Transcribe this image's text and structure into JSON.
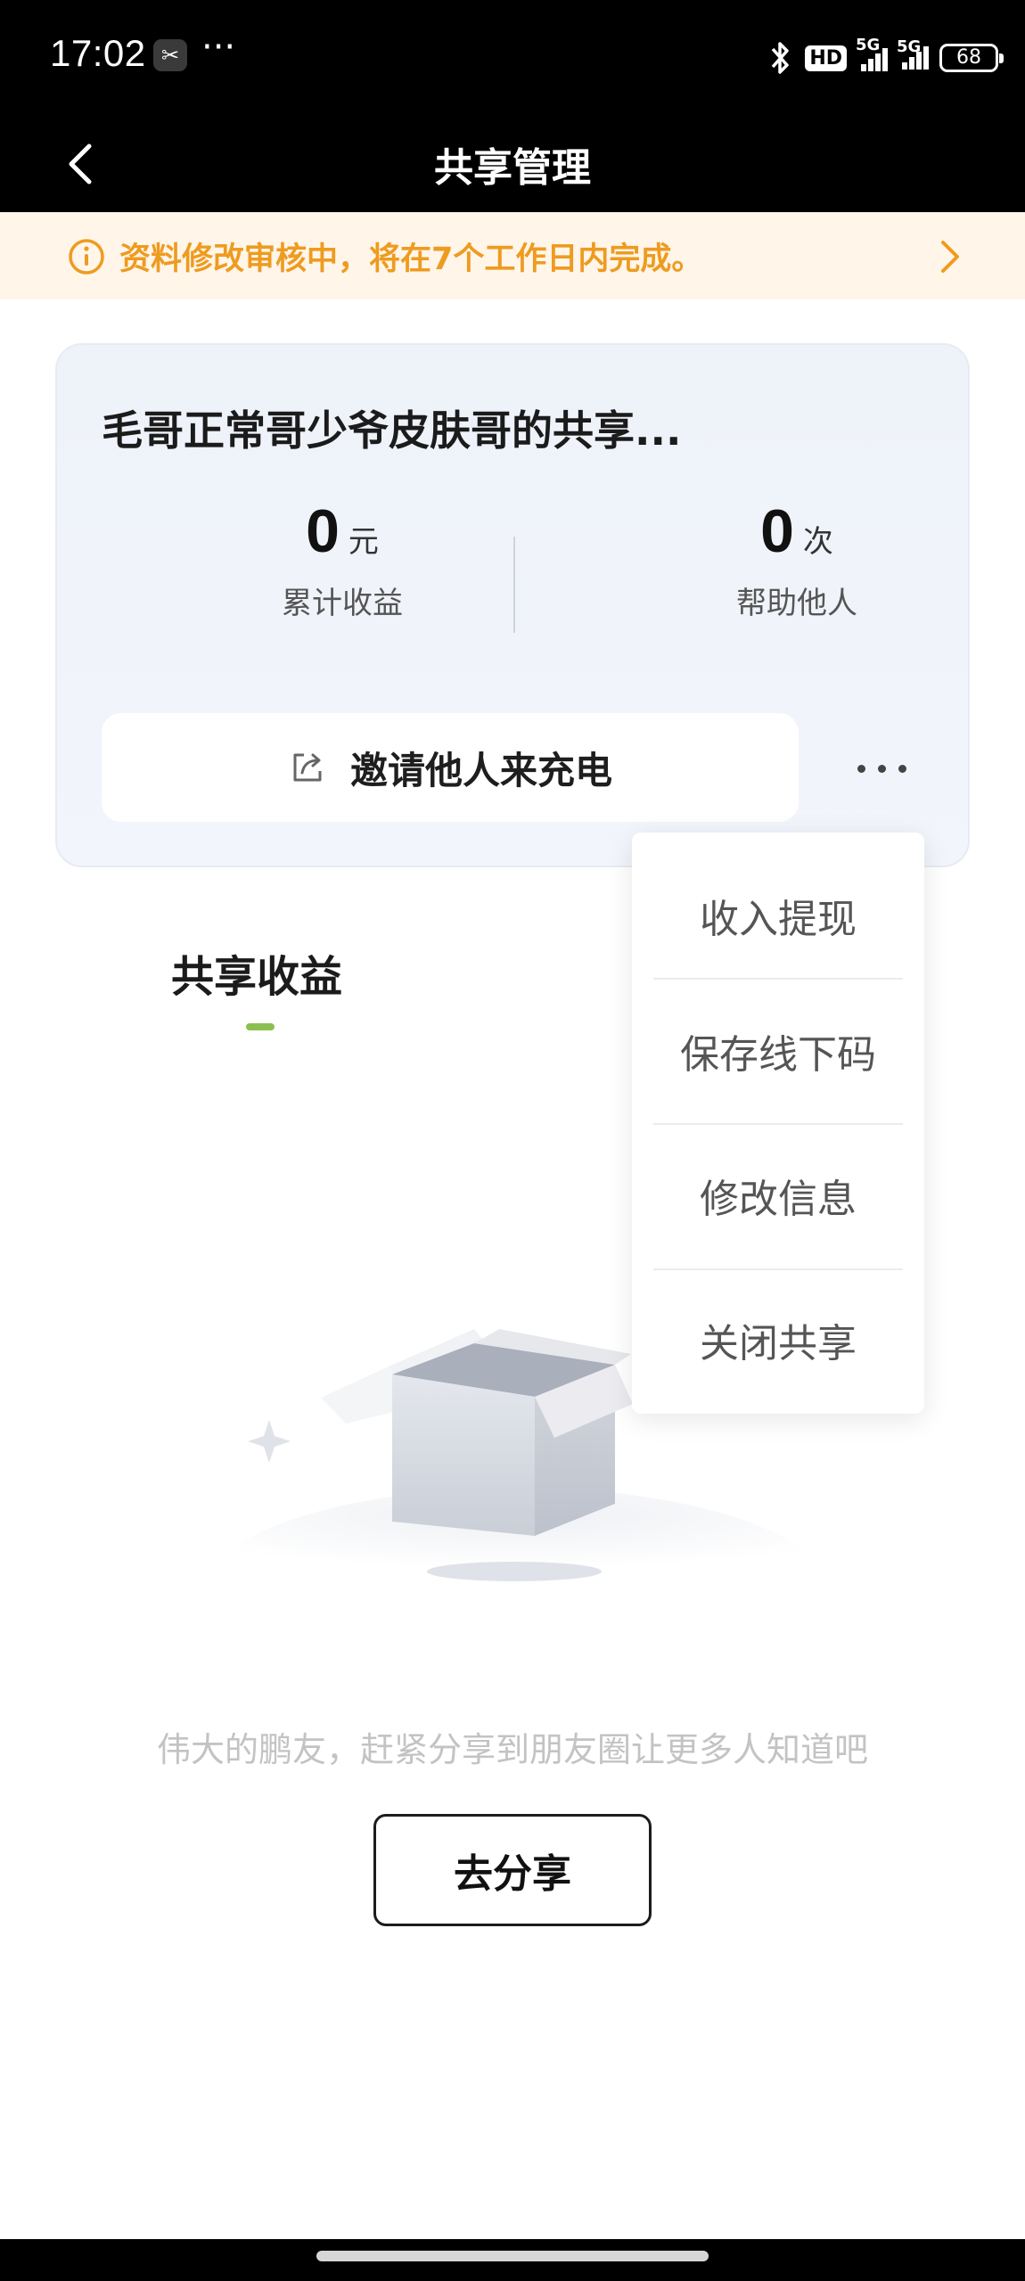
{
  "status_bar": {
    "time": "17:02",
    "notif_icon": "scissors-icon",
    "more": "···",
    "hd_badge": "HD",
    "network_1": "5G",
    "network_2": "5G",
    "battery": "68"
  },
  "nav": {
    "title": "共享管理",
    "back_icon": "chevron-left-icon"
  },
  "notice": {
    "text": "资料修改审核中，将在7个工作日内完成。",
    "icon": "info-circle-icon",
    "arrow_icon": "chevron-right-icon",
    "color": "#ee9b1f"
  },
  "card": {
    "title": "毛哥正常哥少爷皮肤哥的共享...",
    "stats": [
      {
        "value": "0",
        "unit": "元",
        "label": "累计收益"
      },
      {
        "value": "0",
        "unit": "次",
        "label": "帮助他人"
      }
    ],
    "invite_label": "邀请他人来充电",
    "invite_icon": "share-icon",
    "more_icon": "more-dots-icon"
  },
  "menu": {
    "items": [
      "收入提现",
      "保存线下码",
      "修改信息",
      "关闭共享"
    ]
  },
  "section": {
    "title": "共享收益",
    "accent": "#8bbf4f"
  },
  "empty_state": {
    "illustration": "empty-box-illustration",
    "hint": "伟大的鹏友，赶紧分享到朋友圈让更多人知道吧",
    "button_label": "去分享"
  }
}
